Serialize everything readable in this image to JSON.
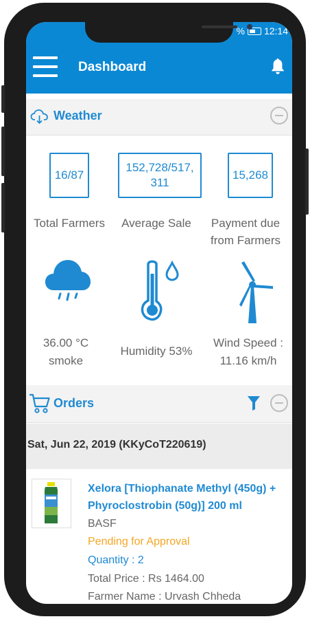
{
  "status_bar": {
    "battery_text": "%",
    "time": "12:14"
  },
  "app_bar": {
    "title": "Dashboard"
  },
  "weather_section": {
    "title": "Weather"
  },
  "stats": [
    {
      "value": "16/87",
      "label": "Total Farmers"
    },
    {
      "value": "152,728/517, 311",
      "label": "Average Sale"
    },
    {
      "value": "15,268",
      "label": "Payment due from Farmers"
    }
  ],
  "weather": {
    "temperature": "36.00 °C",
    "condition": "smoke",
    "humidity": "Humidity 53%",
    "wind_label": "Wind Speed :",
    "wind_value": "11.16 km/h"
  },
  "orders_section": {
    "title": "Orders"
  },
  "order": {
    "date_id": "Sat, Jun 22,  2019 (KKyCoT220619)",
    "product": "Xelora [Thiophanate Methyl (450g) + Phyroclostrobin (50g)] 200 ml",
    "brand": "BASF",
    "status": "Pending for Approval",
    "quantity": "Quantity : 2",
    "total_price": "Total Price : Rs 1464.00",
    "farmer_name": "Farmer Name : Urvash Chheda"
  },
  "colors": {
    "primary": "#0b88d4",
    "accent_text": "#1f8ad2",
    "status_pending": "#f5a623"
  }
}
